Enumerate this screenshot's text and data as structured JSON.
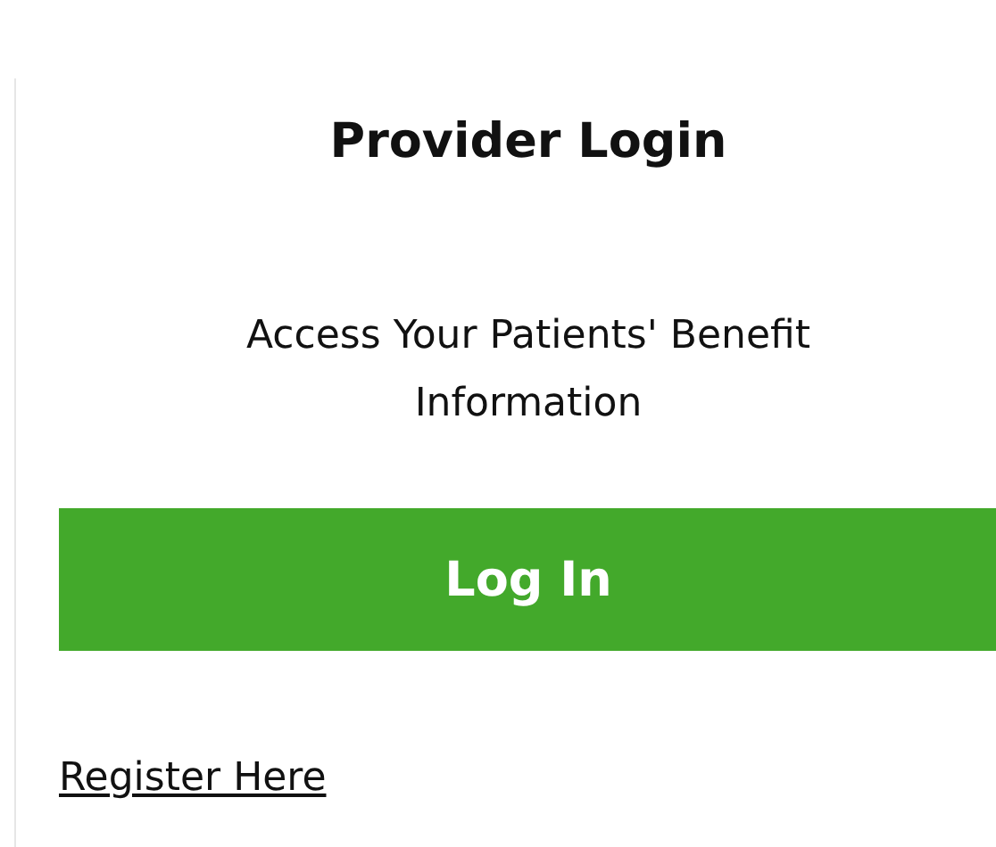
{
  "title": "Provider Login",
  "subtitle": "Access Your Patients' Benefit Information",
  "login_button": "Log In",
  "register_link": "Register Here"
}
